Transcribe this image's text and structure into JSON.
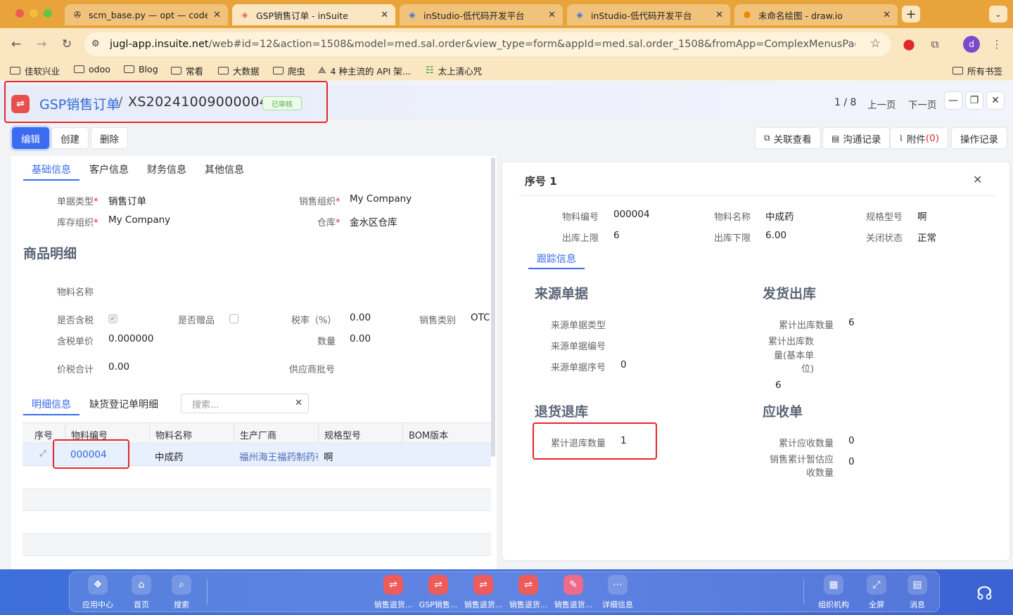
{
  "browser": {
    "tabs": [
      {
        "title": "scm_base.py — opt — code-s",
        "icon": "vscode-icon"
      },
      {
        "title": "GSP销售订单 - inSuite",
        "icon": "insuite-icon"
      },
      {
        "title": "inStudio-低代码开发平台",
        "icon": "insuite-icon"
      },
      {
        "title": "inStudio-低代码开发平台",
        "icon": "insuite-icon"
      },
      {
        "title": "未命名绘图 - draw.io",
        "icon": "drawio-icon"
      }
    ],
    "url_host": "jugl-app.insuite.net",
    "url_path": "/web#id=12&action=1508&model=med.sal.order&view_type=form&appId=med.sal.order_1508&fromApp=ComplexMenusPage&cids=1&men...",
    "profile_letter": "d",
    "bookmarks": [
      "佳软兴业",
      "odoo",
      "Blog",
      "常看",
      "大数据",
      "爬虫",
      "4 种主流的 API 架...",
      "太上清心咒"
    ],
    "all_bookmarks": "所有书签"
  },
  "app": {
    "breadcrumb_parent": "GSP销售订单",
    "breadcrumb_sep": "/",
    "record_code": "XS20241009000004",
    "status": "已审核",
    "pager": "1 / 8",
    "prev_page": "上一页",
    "next_page": "下一页",
    "toolbar": {
      "edit": "编辑",
      "create": "创建",
      "delete": "删除",
      "related": "关联查看",
      "messages": "沟通记录",
      "attachments": "附件",
      "attachments_count": "(0)",
      "history": "操作记录"
    }
  },
  "form": {
    "tabs": [
      "基础信息",
      "客户信息",
      "财务信息",
      "其他信息"
    ],
    "fields": {
      "doc_type_label": "单据类型",
      "doc_type": "销售订单",
      "sales_org_label": "销售组织",
      "sales_org": "My Company",
      "stock_org_label": "库存组织",
      "stock_org": "My Company",
      "warehouse_label": "仓库",
      "warehouse": "金水区仓库"
    },
    "goods_title": "商品明细",
    "goods": {
      "material_name_label": "物料名称",
      "tax_incl_label": "是否含税",
      "gift_label": "是否赠品",
      "tax_rate_label": "税率（%）",
      "tax_rate": "0.00",
      "sales_cat_label": "销售类别",
      "sales_cat": "OTC",
      "unit_price_label": "含税单价",
      "unit_price": "0.000000",
      "qty_label": "数量",
      "qty": "0.00",
      "total_label": "价税合计",
      "total": "0.00",
      "supplier_batch_label": "供应商批号"
    },
    "line_tabs": [
      "明细信息",
      "缺货登记单明细"
    ],
    "search_placeholder": "搜索...",
    "grid_headers": [
      "序号",
      "物料编号",
      "物料名称",
      "生产厂商",
      "规格型号",
      "BOM版本"
    ],
    "grid_rows": [
      {
        "code": "000004",
        "name": "中成药",
        "manufacturer": "福州海王福药制药有限公司",
        "spec": "啊",
        "bom": ""
      }
    ]
  },
  "detail": {
    "title": "序号 1",
    "fields": {
      "mat_code_label": "物料编号",
      "mat_code": "000004",
      "mat_name_label": "物料名称",
      "mat_name": "中成药",
      "spec_label": "规格型号",
      "spec": "啊",
      "out_max_label": "出库上限",
      "out_max": "6",
      "out_min_label": "出库下限",
      "out_min": "6.00",
      "close_label": "关闭状态",
      "close": "正常"
    },
    "tab": "跟踪信息",
    "source_title": "来源单据",
    "source_type_label": "来源单据类型",
    "source_no_label": "来源单据编号",
    "source_seq_label": "来源单据序号",
    "source_seq": "0",
    "delivery_title": "发货出库",
    "out_qty_label": "累计出库数量",
    "out_qty": "6",
    "out_qty_base_label_1": "累计出库数",
    "out_qty_base_label_2": "量(基本单",
    "out_qty_base_label_3": "位)",
    "out_qty_base": "6",
    "return_title": "退货退库",
    "return_qty_label": "累计退库数量",
    "return_qty": "1",
    "receivable_title": "应收单",
    "receivable_qty_label": "累计应收数量",
    "receivable_qty": "0",
    "est_label_1": "销售累计暂估应",
    "est_label_2": "收数量",
    "est_qty": "0"
  },
  "taskbar": {
    "left": [
      "应用中心",
      "首页",
      "搜索"
    ],
    "middle": [
      "销售退货...",
      "GSP销售...",
      "销售退货...",
      "销售退货...",
      "销售退货...",
      "详细信息"
    ],
    "right": [
      "组织机构",
      "全屏",
      "消息"
    ]
  },
  "colors": {
    "accent": "#3b6bf0",
    "highlight_box": "#e5262a",
    "taskbar": "#4a73df",
    "browser_frame": "#e8a43a"
  }
}
